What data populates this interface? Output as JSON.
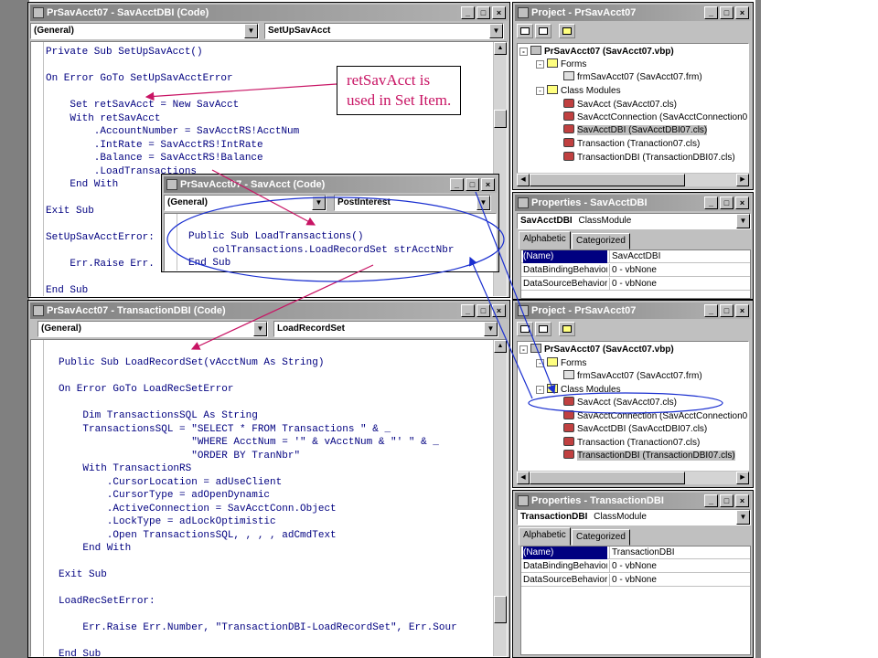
{
  "code_window_1": {
    "title": "PrSavAcct07 - SavAcctDBI (Code)",
    "object_combo": "(General)",
    "proc_combo": "SetUpSavAcct",
    "lines": [
      "Private Sub SetUpSavAcct()",
      "",
      "On Error GoTo SetUpSavAcctError",
      "",
      "    Set retSavAcct = New SavAcct",
      "    With retSavAcct",
      "        .AccountNumber = SavAcctRS!AcctNum",
      "        .IntRate = SavAcctRS!IntRate",
      "        .Balance = SavAcctRS!Balance",
      "        .LoadTransactions",
      "    End With",
      "",
      "Exit Sub",
      "",
      "SetUpSavAcctError:",
      "",
      "    Err.Raise Err.",
      "",
      "End Sub"
    ]
  },
  "code_window_2": {
    "title": "PrSavAcct07 - SavAcct (Code)",
    "object_combo": "(General)",
    "proc_combo": "PostInterest",
    "lines": [
      "Public Sub LoadTransactions()",
      "    colTransactions.LoadRecordSet strAcctNbr",
      "End Sub"
    ]
  },
  "code_window_3": {
    "title": "PrSavAcct07 - TransactionDBI (Code)",
    "object_combo": "(General)",
    "proc_combo": "LoadRecordSet",
    "lines": [
      "Public Sub LoadRecordSet(vAcctNum As String)",
      "",
      "On Error GoTo LoadRecSetError",
      "",
      "    Dim TransactionsSQL As String",
      "    TransactionsSQL = \"SELECT * FROM Transactions \" & _",
      "                      \"WHERE AcctNum = '\" & vAcctNum & \"' \" & _",
      "                      \"ORDER BY TranNbr\"",
      "    With TransactionRS",
      "        .CursorLocation = adUseClient",
      "        .CursorType = adOpenDynamic",
      "        .ActiveConnection = SavAcctConn.Object",
      "        .LockType = adLockOptimistic",
      "        .Open TransactionsSQL, , , , adCmdText",
      "    End With",
      "",
      "Exit Sub",
      "",
      "LoadRecSetError:",
      "",
      "    Err.Raise Err.Number, \"TransactionDBI-LoadRecordSet\", Err.Sour",
      "",
      "End Sub"
    ]
  },
  "project_1": {
    "title": "Project - PrSavAcct07",
    "root": "PrSavAcct07 (SavAcct07.vbp)",
    "forms_folder": "Forms",
    "forms": [
      "frmSavAcct07 (SavAcct07.frm)"
    ],
    "class_folder": "Class Modules",
    "classes": [
      "SavAcct (SavAcct07.cls)",
      "SavAcctConnection (SavAcctConnection0",
      "SavAcctDBI (SavAcctDBI07.cls)",
      "Transaction (Tranaction07.cls)",
      "TransactionDBI (TransactionDBI07.cls)"
    ],
    "selected_index": 2
  },
  "properties_1": {
    "title": "Properties - SavAcctDBI",
    "object_name": "SavAcctDBI",
    "object_type": "ClassModule",
    "tab_alpha": "Alphabetic",
    "tab_cat": "Categorized",
    "rows": [
      {
        "k": "(Name)",
        "v": "SavAcctDBI"
      },
      {
        "k": "DataBindingBehavior",
        "v": "0 - vbNone"
      },
      {
        "k": "DataSourceBehavior",
        "v": "0 - vbNone"
      }
    ]
  },
  "project_2": {
    "title": "Project - PrSavAcct07",
    "root": "PrSavAcct07 (SavAcct07.vbp)",
    "forms_folder": "Forms",
    "forms": [
      "frmSavAcct07 (SavAcct07.frm)"
    ],
    "class_folder": "Class Modules",
    "classes": [
      "SavAcct (SavAcct07.cls)",
      "SavAcctConnection (SavAcctConnection0",
      "SavAcctDBI (SavAcctDBI07.cls)",
      "Transaction (Tranaction07.cls)",
      "TransactionDBI (TransactionDBI07.cls)"
    ],
    "selected_index": 4
  },
  "properties_2": {
    "title": "Properties - TransactionDBI",
    "object_name": "TransactionDBI",
    "object_type": "ClassModule",
    "tab_alpha": "Alphabetic",
    "tab_cat": "Categorized",
    "rows": [
      {
        "k": "(Name)",
        "v": "TransactionDBI"
      },
      {
        "k": "DataBindingBehavior",
        "v": "0 - vbNone"
      },
      {
        "k": "DataSourceBehavior",
        "v": "0 - vbNone"
      }
    ]
  },
  "callout": {
    "line1": "retSavAcct is",
    "line2": "used in Set Item."
  },
  "colors": {
    "annotation": "#c81464",
    "link_arrow": "#1a2fd0",
    "keyword": "#000080"
  }
}
